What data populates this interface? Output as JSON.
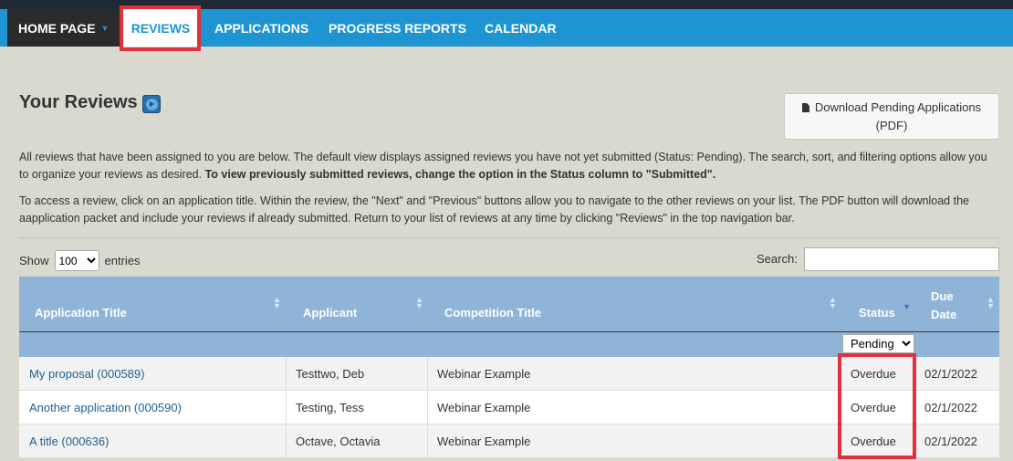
{
  "nav": {
    "home_label": "HOME PAGE",
    "items": [
      {
        "label": "REVIEWS",
        "active": true
      },
      {
        "label": "APPLICATIONS"
      },
      {
        "label": "PROGRESS REPORTS"
      },
      {
        "label": "CALENDAR"
      }
    ]
  },
  "page": {
    "title": "Your Reviews",
    "pdf_button_line1": "Download Pending Applications",
    "pdf_button_line2": "(PDF)",
    "para1_text": "All reviews that have been assigned to you are below. The default view displays assigned reviews you have not yet submitted (Status: Pending). The search, sort, and filtering options allow you to organize your reviews as desired. ",
    "para1_bold": "To view previously submitted reviews, change the option in the Status column to \"Submitted\".",
    "para2": "To access a review, click on an application title. Within the review, the \"Next\" and \"Previous\" buttons allow you to navigate to the other reviews on your list. The PDF button will download the aapplication packet and include your reviews if already submitted. Return to your list of reviews at any time by clicking \"Reviews\" in the top navigation bar."
  },
  "table_controls": {
    "show_label": "Show",
    "entries_value": "100",
    "entries_label": "entries",
    "search_label": "Search:"
  },
  "table": {
    "headers": {
      "application_title": "Application Title",
      "applicant": "Applicant",
      "competition_title": "Competition Title",
      "status": "Status",
      "due_date_line1": "Due",
      "due_date_line2": "Date"
    },
    "status_filter": "Pending",
    "rows": [
      {
        "title": "My proposal (000589)",
        "applicant": "Testtwo, Deb",
        "competition": "Webinar Example",
        "status": "Overdue",
        "due": "02/1/2022"
      },
      {
        "title": "Another application (000590)",
        "applicant": "Testing, Tess",
        "competition": "Webinar Example",
        "status": "Overdue",
        "due": "02/1/2022"
      },
      {
        "title": "A title (000636)",
        "applicant": "Octave, Octavia",
        "competition": "Webinar Example",
        "status": "Overdue",
        "due": "02/1/2022"
      }
    ]
  },
  "colors": {
    "navbar": "#1f94d2",
    "highlight": "#e0323c",
    "table_header": "#8fb4d8"
  }
}
